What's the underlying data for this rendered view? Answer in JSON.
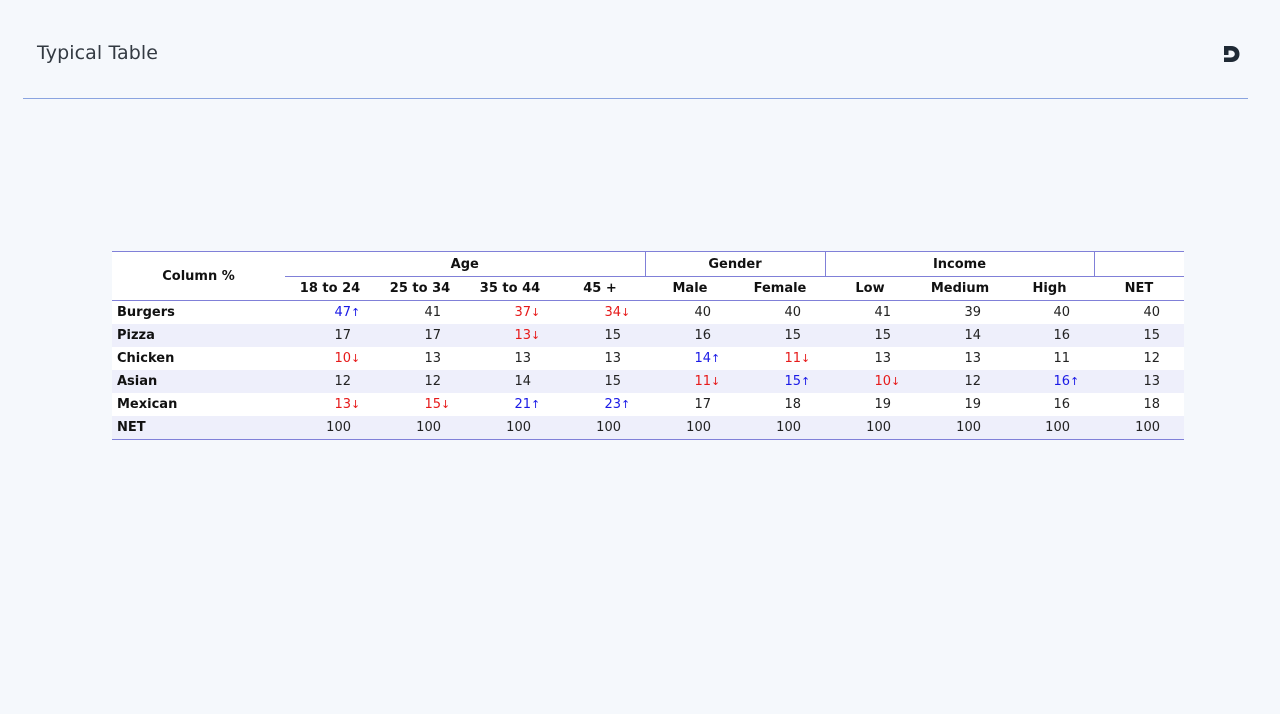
{
  "page": {
    "title": "Typical Table"
  },
  "colors": {
    "background": "#f5f8fc",
    "rule": "#8aa4e0",
    "table_border": "#8080d8",
    "band": "#eeeffb",
    "up": "#1a1ae6",
    "down": "#e61a1a"
  },
  "table": {
    "corner_label": "Column %",
    "groups": [
      "Age",
      "Gender",
      "Income",
      ""
    ],
    "columns": [
      "18 to 24",
      "25 to 34",
      "35 to 44",
      "45 +",
      "Male",
      "Female",
      "Low",
      "Medium",
      "High",
      "NET"
    ],
    "rows": [
      {
        "label": "Burgers",
        "cells": [
          {
            "v": "47",
            "d": "up",
            "i": "arrow-up-icon"
          },
          {
            "v": "41",
            "d": ""
          },
          {
            "v": "37",
            "d": "down",
            "i": "arrow-down-icon"
          },
          {
            "v": "34",
            "d": "down",
            "i": "arrow-down-icon"
          },
          {
            "v": "40",
            "d": ""
          },
          {
            "v": "40",
            "d": ""
          },
          {
            "v": "41",
            "d": ""
          },
          {
            "v": "39",
            "d": ""
          },
          {
            "v": "40",
            "d": ""
          },
          {
            "v": "40",
            "d": ""
          }
        ]
      },
      {
        "label": "Pizza",
        "cells": [
          {
            "v": "17",
            "d": ""
          },
          {
            "v": "17",
            "d": ""
          },
          {
            "v": "13",
            "d": "down",
            "i": "arrow-down-icon"
          },
          {
            "v": "15",
            "d": ""
          },
          {
            "v": "16",
            "d": ""
          },
          {
            "v": "15",
            "d": ""
          },
          {
            "v": "15",
            "d": ""
          },
          {
            "v": "14",
            "d": ""
          },
          {
            "v": "16",
            "d": ""
          },
          {
            "v": "15",
            "d": ""
          }
        ]
      },
      {
        "label": "Chicken",
        "cells": [
          {
            "v": "10",
            "d": "down",
            "i": "arrow-down-icon"
          },
          {
            "v": "13",
            "d": ""
          },
          {
            "v": "13",
            "d": ""
          },
          {
            "v": "13",
            "d": ""
          },
          {
            "v": "14",
            "d": "up",
            "i": "arrow-up-icon"
          },
          {
            "v": "11",
            "d": "down",
            "i": "arrow-down-icon"
          },
          {
            "v": "13",
            "d": ""
          },
          {
            "v": "13",
            "d": ""
          },
          {
            "v": "11",
            "d": ""
          },
          {
            "v": "12",
            "d": ""
          }
        ]
      },
      {
        "label": "Asian",
        "cells": [
          {
            "v": "12",
            "d": ""
          },
          {
            "v": "12",
            "d": ""
          },
          {
            "v": "14",
            "d": ""
          },
          {
            "v": "15",
            "d": ""
          },
          {
            "v": "11",
            "d": "down",
            "i": "arrow-down-icon"
          },
          {
            "v": "15",
            "d": "up",
            "i": "arrow-up-icon"
          },
          {
            "v": "10",
            "d": "down",
            "i": "arrow-down-icon"
          },
          {
            "v": "12",
            "d": ""
          },
          {
            "v": "16",
            "d": "up",
            "i": "arrow-up-icon"
          },
          {
            "v": "13",
            "d": ""
          }
        ]
      },
      {
        "label": "Mexican",
        "cells": [
          {
            "v": "13",
            "d": "down",
            "i": "arrow-down-icon"
          },
          {
            "v": "15",
            "d": "down",
            "i": "arrow-down-icon"
          },
          {
            "v": "21",
            "d": "up",
            "i": "arrow-up-icon"
          },
          {
            "v": "23",
            "d": "up",
            "i": "arrow-up-icon"
          },
          {
            "v": "17",
            "d": ""
          },
          {
            "v": "18",
            "d": ""
          },
          {
            "v": "19",
            "d": ""
          },
          {
            "v": "19",
            "d": ""
          },
          {
            "v": "16",
            "d": ""
          },
          {
            "v": "18",
            "d": ""
          }
        ]
      },
      {
        "label": "NET",
        "cells": [
          {
            "v": "100",
            "d": ""
          },
          {
            "v": "100",
            "d": ""
          },
          {
            "v": "100",
            "d": ""
          },
          {
            "v": "100",
            "d": ""
          },
          {
            "v": "100",
            "d": ""
          },
          {
            "v": "100",
            "d": ""
          },
          {
            "v": "100",
            "d": ""
          },
          {
            "v": "100",
            "d": ""
          },
          {
            "v": "100",
            "d": ""
          },
          {
            "v": "100",
            "d": ""
          }
        ]
      }
    ]
  }
}
